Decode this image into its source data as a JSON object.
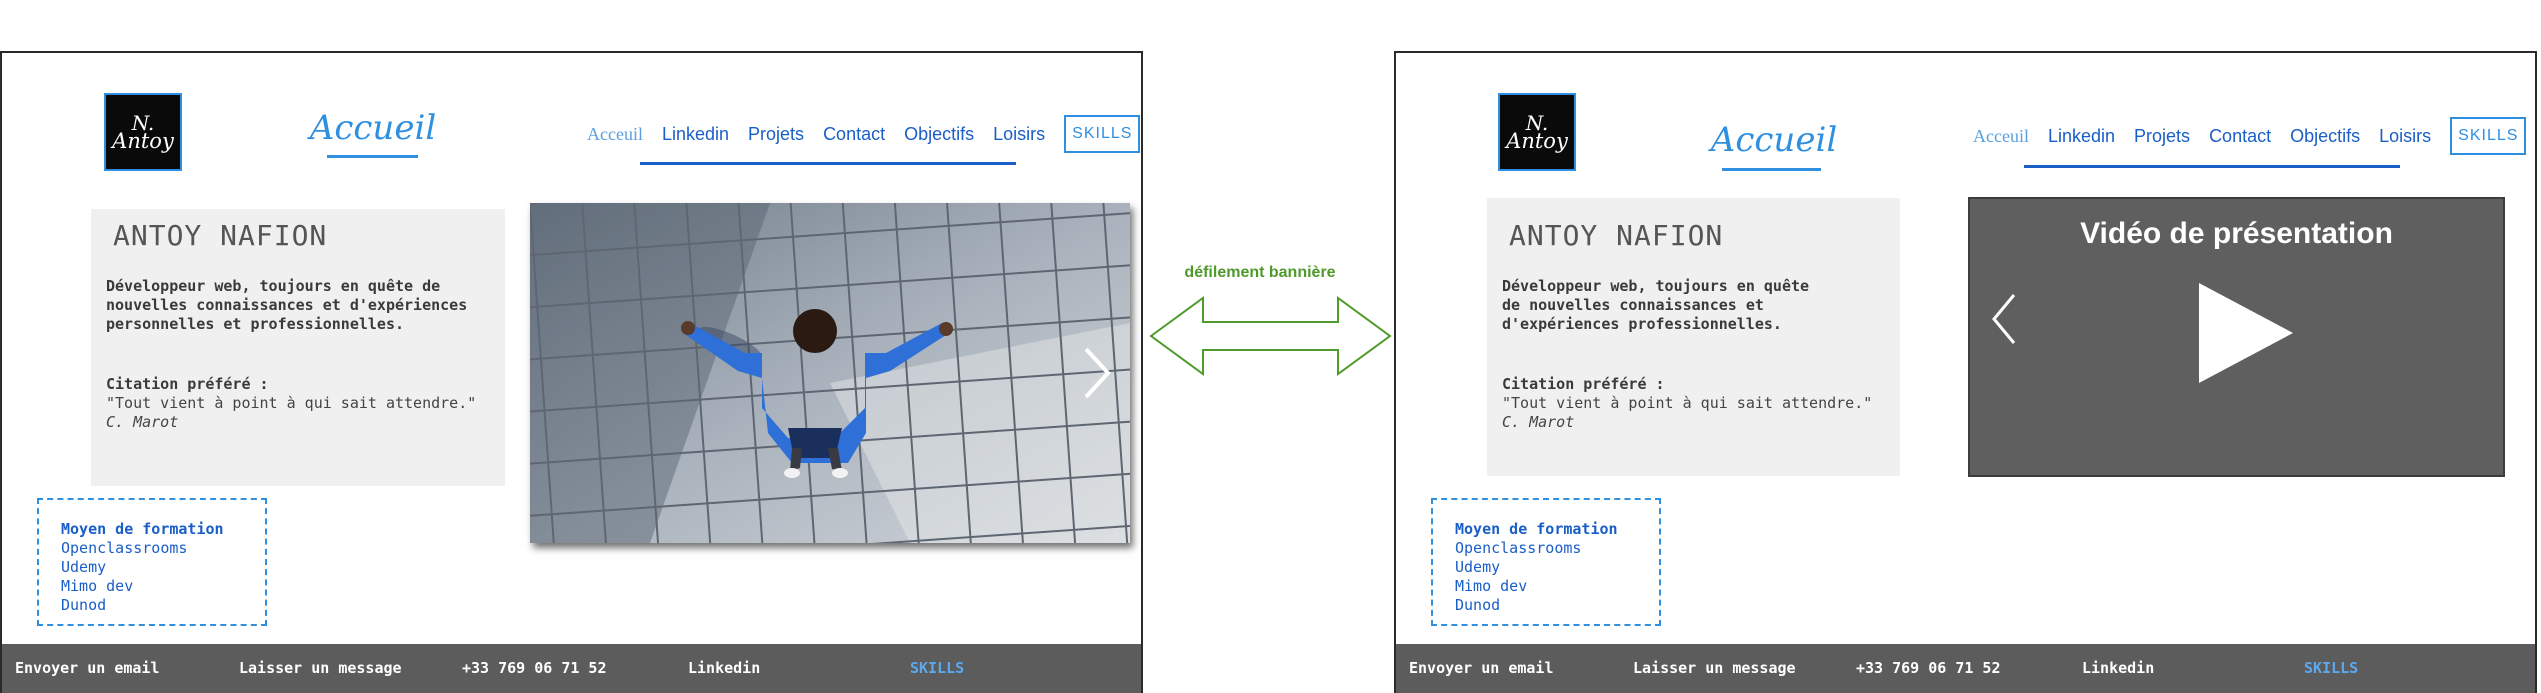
{
  "screens": [
    {
      "logo": {
        "line1": "N.",
        "line2": "Antoy"
      },
      "page_title": "Accueil",
      "nav": {
        "items": [
          "Acceuil",
          "Linkedin",
          "Projets",
          "Contact",
          "Objectifs",
          "Loisirs"
        ],
        "skills": "SKILLS"
      },
      "profile": {
        "name": "ANTOY NAFION",
        "description": "Développeur web, toujours en quête de nouvelles connaissances et d'expériences personnelles et professionnelles.",
        "quote_title": "Citation préféré :",
        "quote": "\"Tout vient à point à qui sait attendre.\"",
        "author": "C. Marot"
      },
      "training": {
        "title": "Moyen de formation",
        "items": [
          "Openclassrooms",
          "Udemy",
          "Mimo dev",
          "Dunod"
        ]
      },
      "footer": [
        "Envoyer un email",
        "Laisser un message",
        "+33 769 06 71 52",
        "Linkedin",
        "SKILLS"
      ]
    },
    {
      "logo": {
        "line1": "N.",
        "line2": "Antoy"
      },
      "page_title": "Accueil",
      "nav": {
        "items": [
          "Acceuil",
          "Linkedin",
          "Projets",
          "Contact",
          "Objectifs",
          "Loisirs"
        ],
        "skills": "SKILLS"
      },
      "profile": {
        "name": "ANTOY NAFION",
        "description": "Développeur web, toujours en quête de nouvelles connaissances et d'expériences professionnelles.",
        "quote_title": "Citation préféré :",
        "quote": "\"Tout vient à point à qui sait attendre.\"",
        "author": "C. Marot"
      },
      "video": {
        "title": "Vidéo de présentation"
      },
      "training": {
        "title": "Moyen de formation",
        "items": [
          "Openclassrooms",
          "Udemy",
          "Mimo dev",
          "Dunod"
        ]
      },
      "footer": [
        "Envoyer un email",
        "Laisser un message",
        "+33 769 06 71 52",
        "Linkedin",
        "SKILLS"
      ]
    }
  ],
  "annotation": {
    "label": "défilement bannière"
  },
  "colors": {
    "accent": "#2f8fe0",
    "nav_link": "#1a5ec7",
    "footer_bg": "#5c5c5c",
    "annotation": "#4e9a2a"
  },
  "icons": [
    "banner-next-chevron-icon",
    "video-prev-chevron-icon",
    "play-icon",
    "double-arrow-icon"
  ]
}
